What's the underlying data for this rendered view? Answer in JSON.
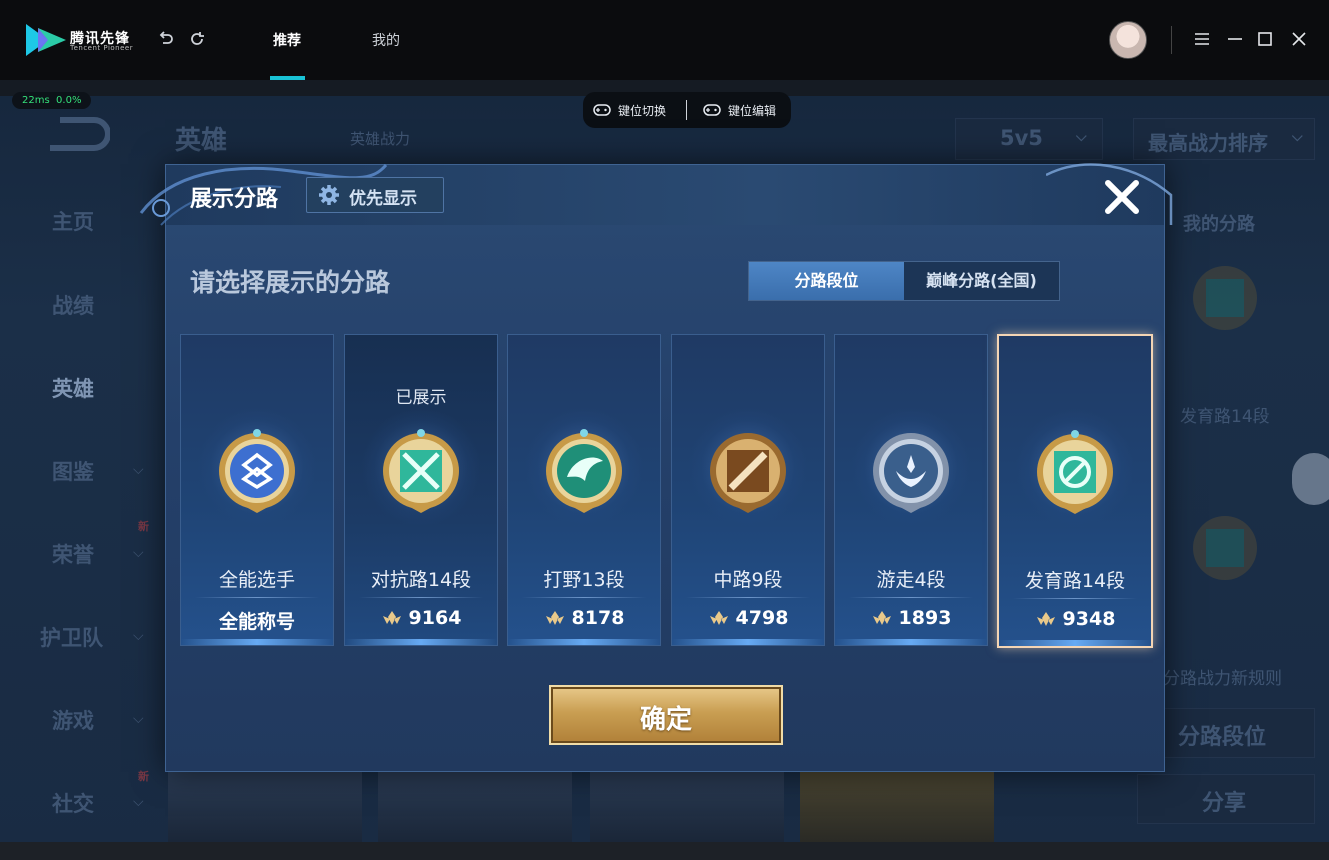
{
  "app": {
    "title": "腾讯先锋",
    "subtitle": "Tencent Pioneer",
    "tabs": [
      {
        "label": "推荐",
        "active": true
      },
      {
        "label": "我的",
        "active": false
      }
    ],
    "accent_color": "#19c3d5"
  },
  "status": {
    "ping": "22ms",
    "loss": "0.0%"
  },
  "keybar": {
    "switch_label": "键位切换",
    "edit_label": "键位编辑"
  },
  "background": {
    "sidebar": [
      "主页",
      "战绩",
      "英雄",
      "图鉴",
      "荣誉",
      "护卫队",
      "游戏",
      "社交"
    ],
    "new_badge": "新",
    "header_title": "英雄",
    "header_sub": "英雄战力",
    "mode_select": "5v5",
    "sort_select": "最高战力排序",
    "right_title": "我的分路",
    "right_lane": "发育路14段",
    "right_rule": "分路战力新规则",
    "right_btn1": "分路段位",
    "right_btn2": "分享"
  },
  "modal": {
    "title": "展示分路",
    "pref_button": "优先显示",
    "subtitle": "请选择展示的分路",
    "segment": {
      "selected": "分路段位",
      "other": "巅峰分路(全国)"
    },
    "shown_note": "已展示",
    "cards": [
      {
        "name": "全能选手",
        "value": "全能称号",
        "has_icon": false,
        "emblem": "allround-emblem-icon",
        "color": "#3d6fd0"
      },
      {
        "name": "对抗路14段",
        "value": "9164",
        "has_icon": true,
        "emblem": "clash-lane-emblem-icon",
        "color": "#2fb79b",
        "shown": true
      },
      {
        "name": "打野13段",
        "value": "8178",
        "has_icon": true,
        "emblem": "jungle-emblem-icon",
        "color": "#2aa587"
      },
      {
        "name": "中路9段",
        "value": "4798",
        "has_icon": true,
        "emblem": "mid-lane-emblem-icon",
        "color": "#c78a3e"
      },
      {
        "name": "游走4段",
        "value": "1893",
        "has_icon": true,
        "emblem": "roam-emblem-icon",
        "color": "#8aa2c4"
      },
      {
        "name": "发育路14段",
        "value": "9348",
        "has_icon": true,
        "emblem": "farm-lane-emblem-icon",
        "color": "#2fb79b",
        "selected": true
      }
    ],
    "confirm_label": "确定"
  }
}
